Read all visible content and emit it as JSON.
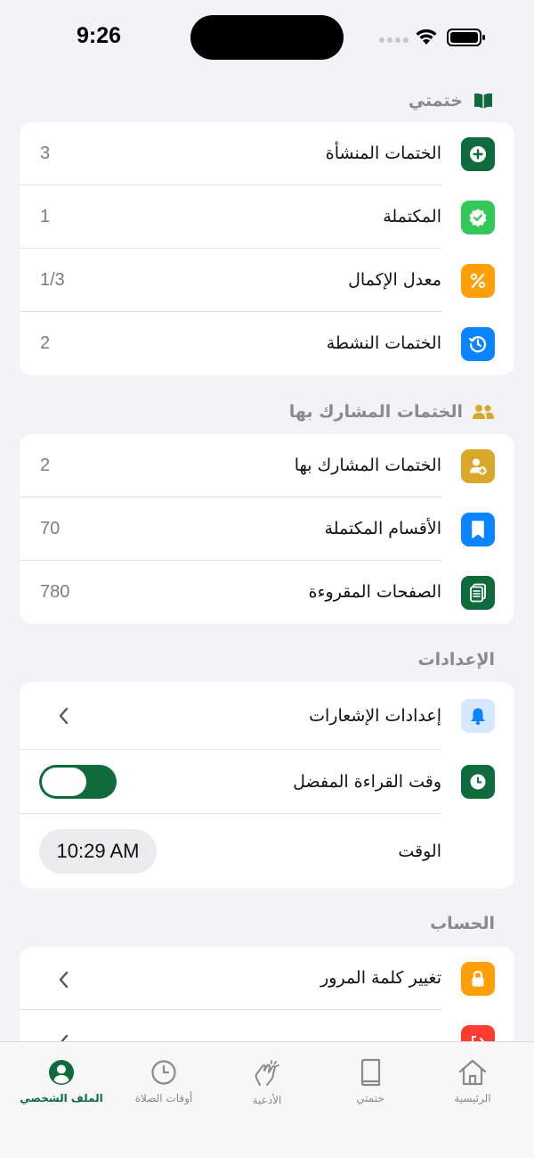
{
  "status": {
    "time": "9:26"
  },
  "sections": {
    "my_khatmas": {
      "title": "ختمتي",
      "rows": [
        {
          "label": "الختمات المنشأة",
          "value": "3"
        },
        {
          "label": "المكتملة",
          "value": "1"
        },
        {
          "label": "معدل الإكمال",
          "value": "1/3"
        },
        {
          "label": "الختمات النشطة",
          "value": "2"
        }
      ]
    },
    "shared": {
      "title": "الختمات المشارك بها",
      "rows": [
        {
          "label": "الختمات المشارك بها",
          "value": "2"
        },
        {
          "label": "الأقسام المكتملة",
          "value": "70"
        },
        {
          "label": "الصفحات المقروءة",
          "value": "780"
        }
      ]
    },
    "settings": {
      "title": "الإعدادات",
      "notifications_label": "إعدادات الإشعارات",
      "preferred_time_label": "وقت القراءة المفضل",
      "preferred_time_enabled": true,
      "time_label": "الوقت",
      "time_value": "10:29 AM"
    },
    "account": {
      "title": "الحساب",
      "change_password_label": "تغيير كلمة المرور"
    }
  },
  "tabs": [
    {
      "label": "الرئيسية",
      "icon": "home-icon"
    },
    {
      "label": "ختمتي",
      "icon": "book-icon"
    },
    {
      "label": "الأدعية",
      "icon": "praying-hands-icon"
    },
    {
      "label": "أوقات الصلاة",
      "icon": "clock-icon"
    },
    {
      "label": "الملف الشخصي",
      "icon": "profile-icon",
      "active": true
    }
  ],
  "colors": {
    "primary_green": "#0f6b3c",
    "light_green": "#34c759",
    "orange": "#ff9f0a",
    "blue": "#0a84ff",
    "gold": "#d9a82a",
    "red": "#ff3b30"
  }
}
